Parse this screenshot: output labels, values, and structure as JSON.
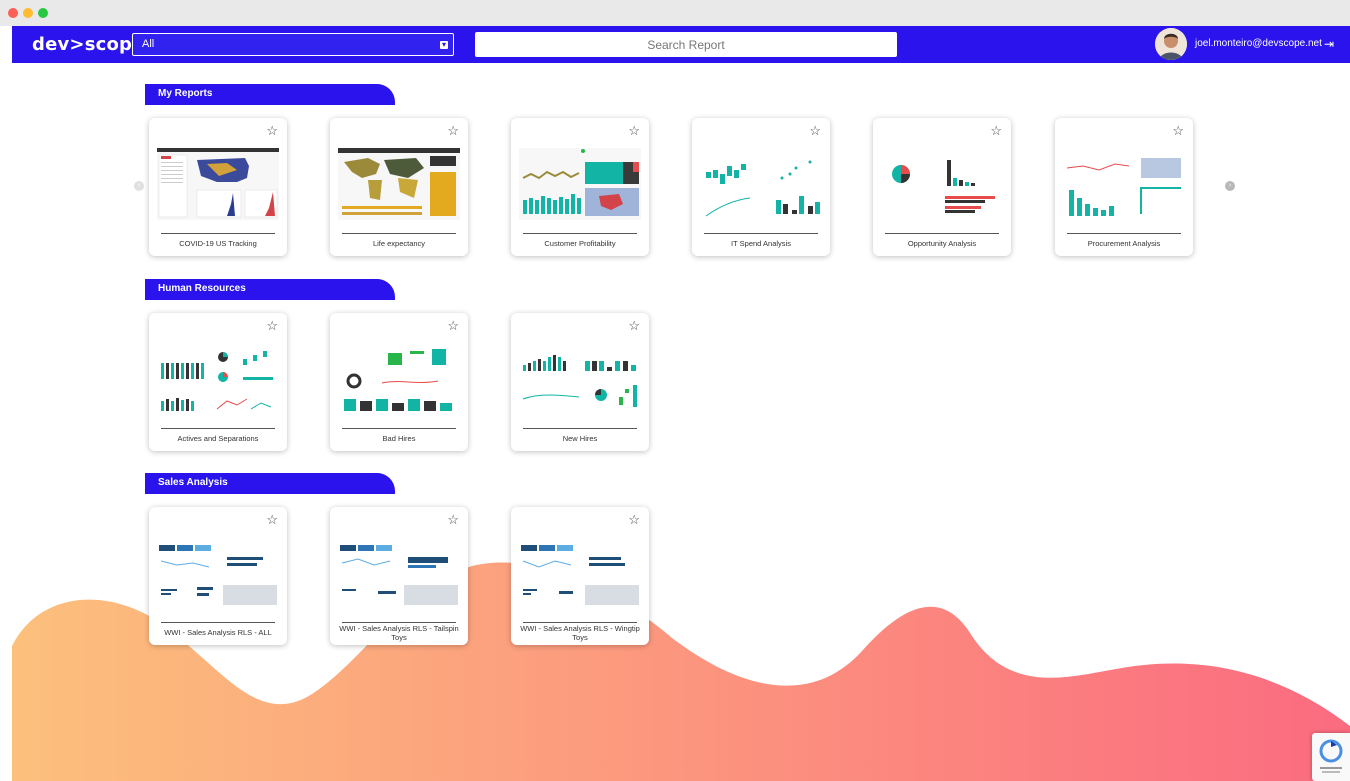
{
  "app": {
    "logo_text": "dev>scope",
    "filter_value": "All",
    "search_placeholder": "Search Report",
    "user_email": "joel.monteiro@devscope.net"
  },
  "colors": {
    "brand": "#2a13ec",
    "wave_start": "#fcc07c",
    "wave_end": "#fb6b80",
    "teal": "#12b5a5"
  },
  "sections": [
    {
      "name": "My Reports",
      "reports": [
        {
          "title": "COVID-19 US Tracking"
        },
        {
          "title": "Life expectancy"
        },
        {
          "title": "Customer Profitability"
        },
        {
          "title": "IT Spend Analysis"
        },
        {
          "title": "Opportunity Analysis"
        },
        {
          "title": "Procurement Analysis"
        }
      ]
    },
    {
      "name": "Human Resources",
      "reports": [
        {
          "title": "Actives and Separations"
        },
        {
          "title": "Bad Hires"
        },
        {
          "title": "New Hires"
        }
      ]
    },
    {
      "name": "Sales Analysis",
      "reports": [
        {
          "title": "WWI - Sales Analysis RLS - ALL"
        },
        {
          "title": "WWI - Sales Analysis RLS - Tailspin Toys"
        },
        {
          "title": "WWI - Sales Analysis RLS - Wingtip Toys"
        }
      ]
    }
  ],
  "icons": {
    "star": "star-icon",
    "logout": "logout-icon",
    "chevron": "chevron-down-icon",
    "prev": "carousel-prev-icon",
    "next": "carousel-next-icon"
  }
}
